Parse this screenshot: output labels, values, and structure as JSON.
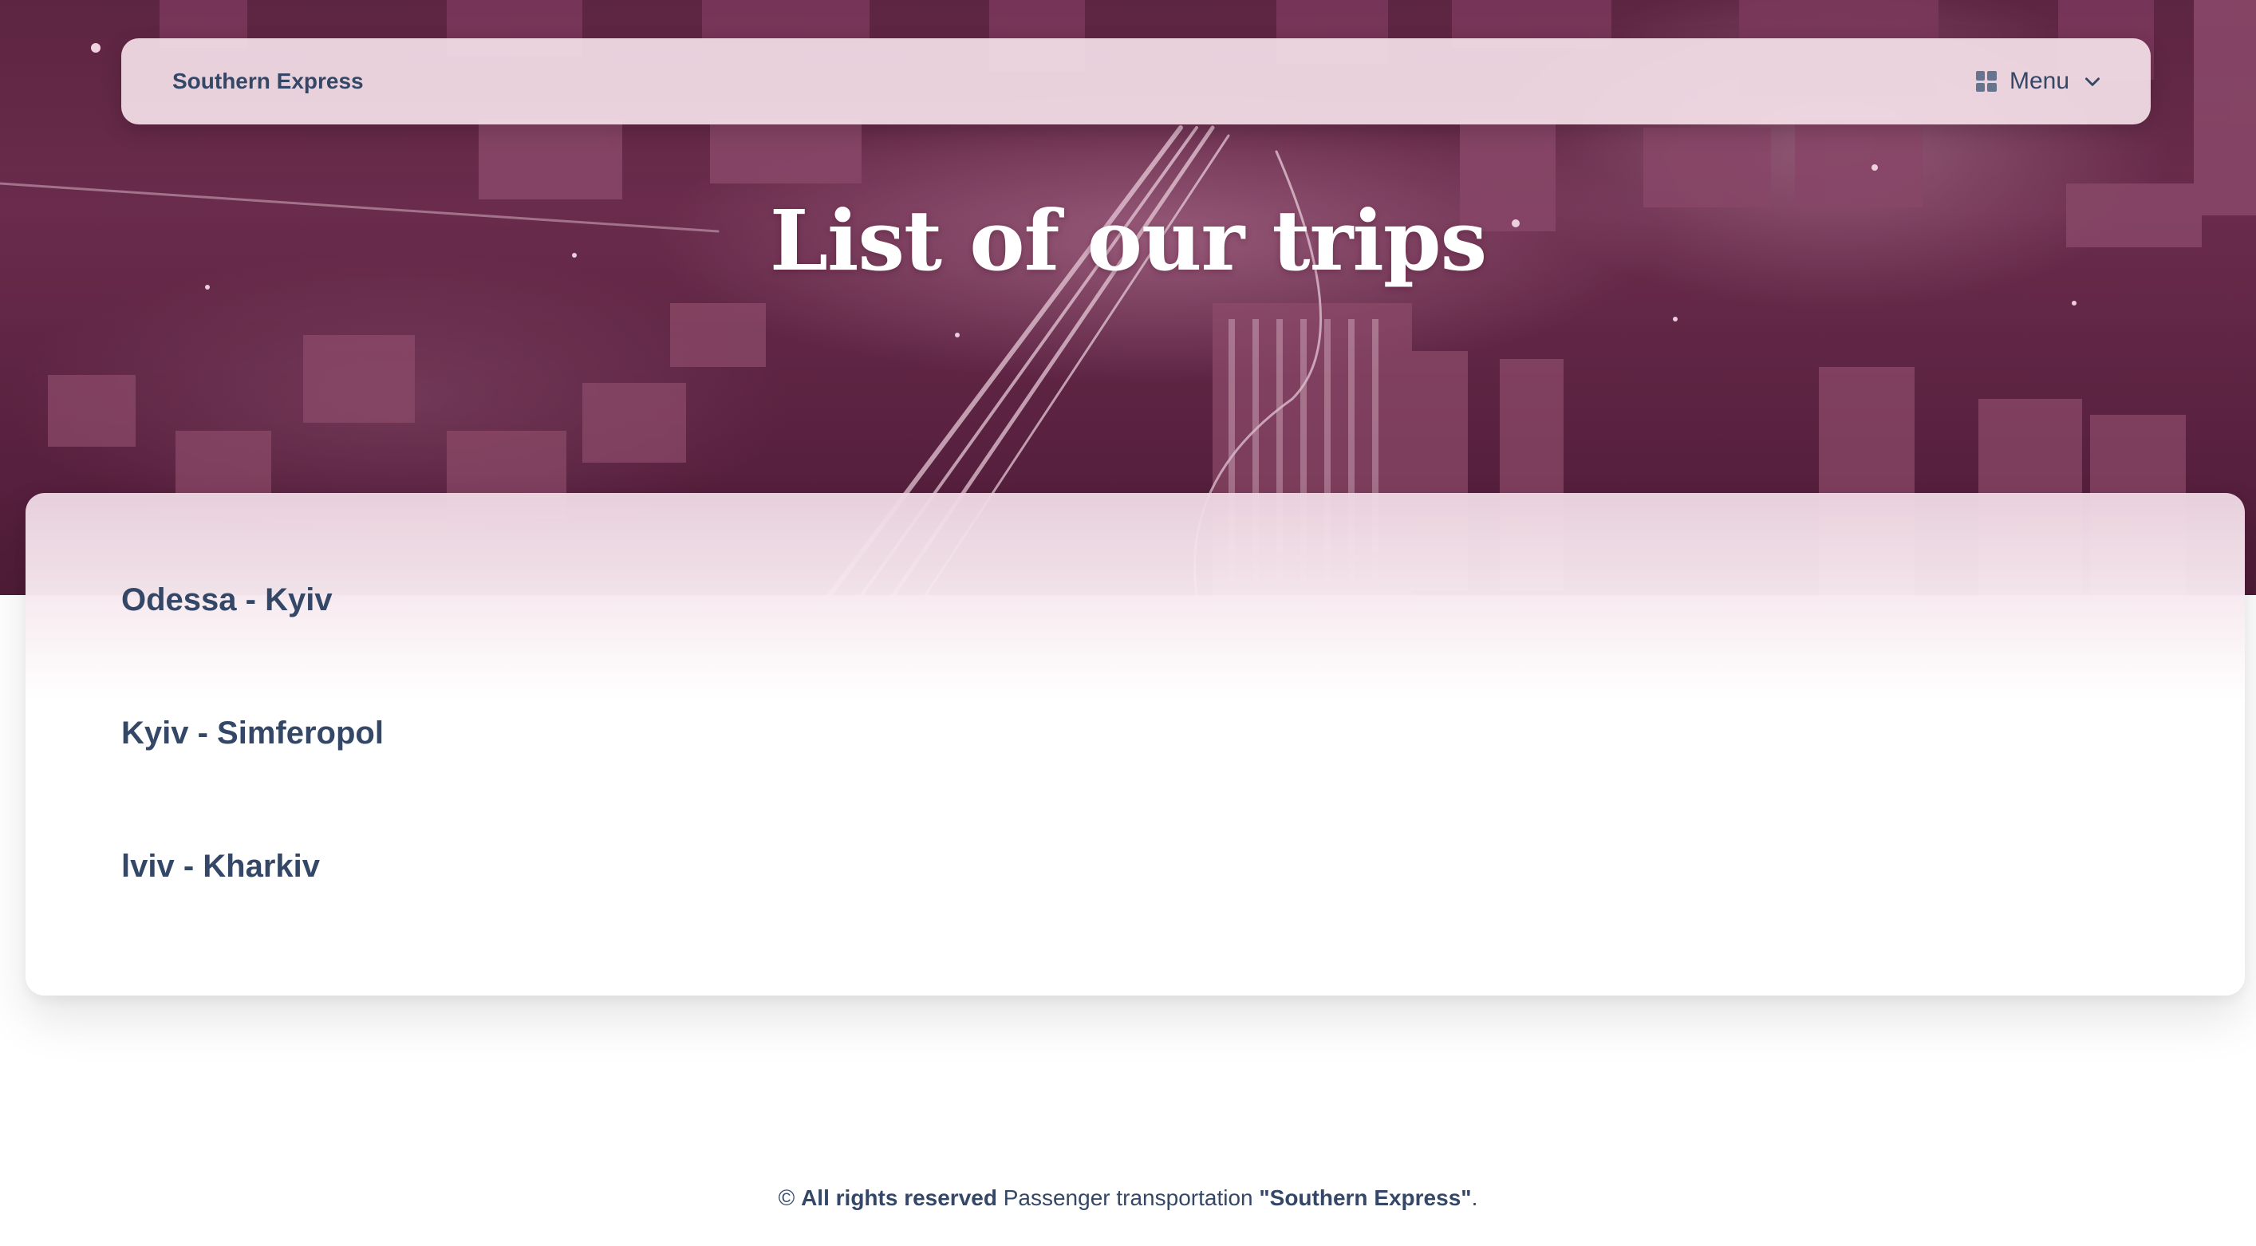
{
  "navbar": {
    "brand": "Southern Express",
    "menu_label": "Menu"
  },
  "hero": {
    "title": "List of our trips"
  },
  "trips": [
    {
      "label": "Odessa - Kyiv"
    },
    {
      "label": "Kyiv - Simferopol"
    },
    {
      "label": "lviv - Kharkiv"
    }
  ],
  "footer": {
    "copyright_symbol": "©",
    "rights": "All rights reserved",
    "text": "Passenger transportation",
    "company_quoted": "\"Southern Express\"",
    "period": "."
  },
  "icons": {
    "menu": "dashboard-grid-icon",
    "dropdown": "chevron-down-icon"
  },
  "colors": {
    "text_primary": "#344767",
    "hero_tint": "#6b2d4d",
    "navbar_bg": "#f5e1e9"
  }
}
